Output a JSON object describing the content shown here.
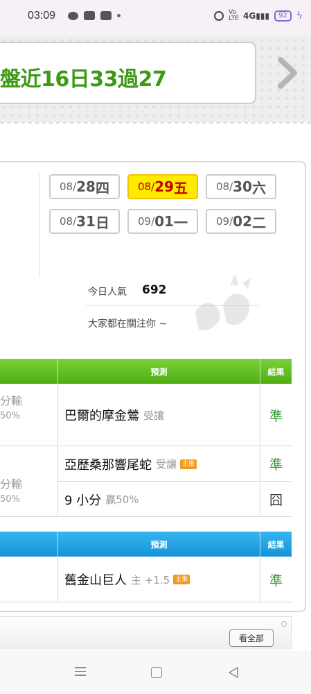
{
  "status_bar": {
    "time": "03:09",
    "battery": "92",
    "network": "4G",
    "vo_label": "Vo\nLTE"
  },
  "banner": {
    "title": "盤近16日33過27",
    "next_icon": "chevron-right-icon"
  },
  "dates": [
    {
      "month": "08/",
      "day": "28",
      "weekday": " 四",
      "active": false
    },
    {
      "month": "08/",
      "day": "29",
      "weekday": " 五",
      "active": true
    },
    {
      "month": "08/",
      "day": "30",
      "weekday": " 六",
      "active": false
    },
    {
      "month": "08/",
      "day": "31",
      "weekday": " 日",
      "active": false
    },
    {
      "month": "09/",
      "day": "01",
      "weekday": " 一",
      "active": false
    },
    {
      "month": "09/",
      "day": "02",
      "weekday": " 二",
      "active": false
    }
  ],
  "popularity": {
    "label": "今日人氣",
    "value": "692",
    "subtitle": "大家都在關注你 ~"
  },
  "table1": {
    "header_pred": "預測",
    "header_result": "結果",
    "rows": [
      {
        "left_main": "分輸",
        "left_sub": "50%",
        "team": "巴爾的摩金鶯",
        "note": "受讓",
        "badge": "",
        "result": "準"
      },
      {
        "left_main": "分輸",
        "left_sub": "50%",
        "team": "亞歷桑那響尾蛇",
        "note": "受讓",
        "badge": "主推",
        "result": "準",
        "second_team": "9 小分",
        "second_note": "贏50%",
        "second_result": "囧"
      }
    ]
  },
  "table2": {
    "header_pred": "預測",
    "header_result": "結果",
    "rows": [
      {
        "team": "舊金山巨人",
        "note": "主 +1.5",
        "badge": "主推",
        "result": "準"
      }
    ]
  },
  "view_all": "看全部",
  "colors": {
    "accent_green": "#3c9a14",
    "header_green": "#5cbd1e",
    "header_blue": "#1aa0e0",
    "active_date": "#ffea00",
    "result_ok": "#2e9a2e"
  }
}
